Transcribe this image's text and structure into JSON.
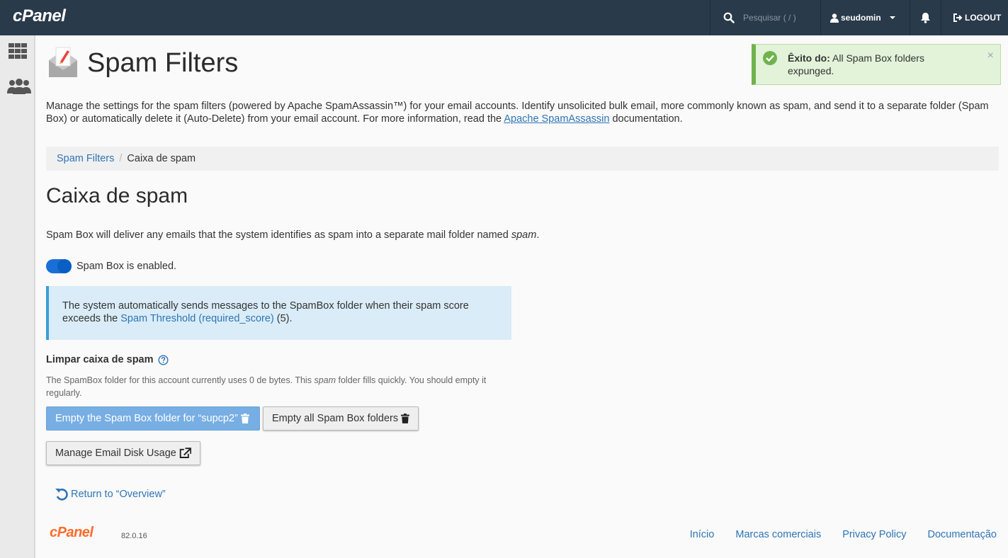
{
  "app": {
    "logo": "cPanel",
    "version": "82.0.16"
  },
  "topbar": {
    "search_placeholder": "Pesquisar ( / )",
    "username": "seudomin",
    "logout_label": "LOGOUT"
  },
  "sidebar": {
    "items": [
      {
        "name": "apps-grid-icon"
      },
      {
        "name": "users-icon"
      }
    ]
  },
  "header": {
    "title": "Spam Filters"
  },
  "description": {
    "text_before": "Manage the settings for the spam filters (powered by Apache SpamAssassin™) for your email accounts. Identify unsolicited bulk email, more commonly known as spam, and send it to a separate folder (Spam Box) or automatically delete it (Auto-Delete) from your email account. For more information, read the ",
    "link": "Apache SpamAssassin",
    "text_after": " documentation."
  },
  "alert": {
    "title": "Êxito do:",
    "message": " All Spam Box folders expunged.",
    "close": "×"
  },
  "breadcrumb": {
    "parent": "Spam Filters",
    "separator": "/",
    "current": "Caixa de spam"
  },
  "section": {
    "title": "Caixa de spam",
    "intro_before": "Spam Box will deliver any emails that the system identifies as spam into a separate mail folder named ",
    "intro_em": "spam",
    "intro_after": "."
  },
  "toggle": {
    "enabled": true,
    "label": "Spam Box is enabled."
  },
  "info": {
    "text_before": "The system automatically sends messages to the SpamBox folder when their spam score exceeds the ",
    "link": "Spam Threshold (required_score)",
    "text_after": " (5)."
  },
  "purge": {
    "label": "Limpar caixa de spam",
    "desc_before": "The SpamBox folder for this account currently uses 0 de bytes. This ",
    "desc_em": "spam",
    "desc_after": " folder fills quickly. You should empty it regularly."
  },
  "buttons": {
    "empty_account": "Empty the Spam Box folder for “supcp2”",
    "empty_all": "Empty all Spam Box folders",
    "disk_usage": "Manage Email Disk Usage"
  },
  "return_link": "Return to “Overview”",
  "footer": {
    "links": [
      "Início",
      "Marcas comerciais",
      "Privacy Policy",
      "Documentação"
    ]
  },
  "colors": {
    "topbar": "#293a4a",
    "accent": "#2e74b5",
    "success": "#6fb34d",
    "brand_orange": "#ff6c2c"
  }
}
